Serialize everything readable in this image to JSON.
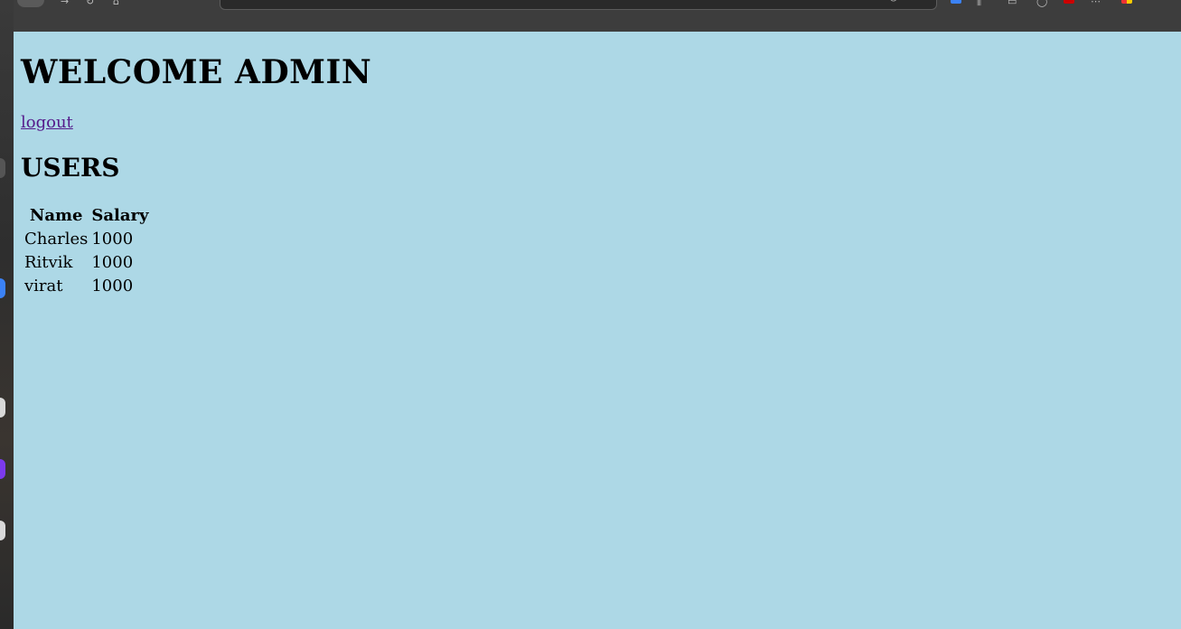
{
  "page": {
    "title": "WELCOME ADMIN",
    "logout_label": "logout",
    "section_title": "USERS"
  },
  "users_table": {
    "headers": [
      "Name",
      "Salary"
    ],
    "rows": [
      [
        "Charles",
        "1000"
      ],
      [
        "Ritvik",
        "1000"
      ],
      [
        "virat",
        "1000"
      ]
    ]
  },
  "colors": {
    "page_background": "#add8e6",
    "link_visited": "#551a8b",
    "chrome_background": "#3d3d3d"
  }
}
